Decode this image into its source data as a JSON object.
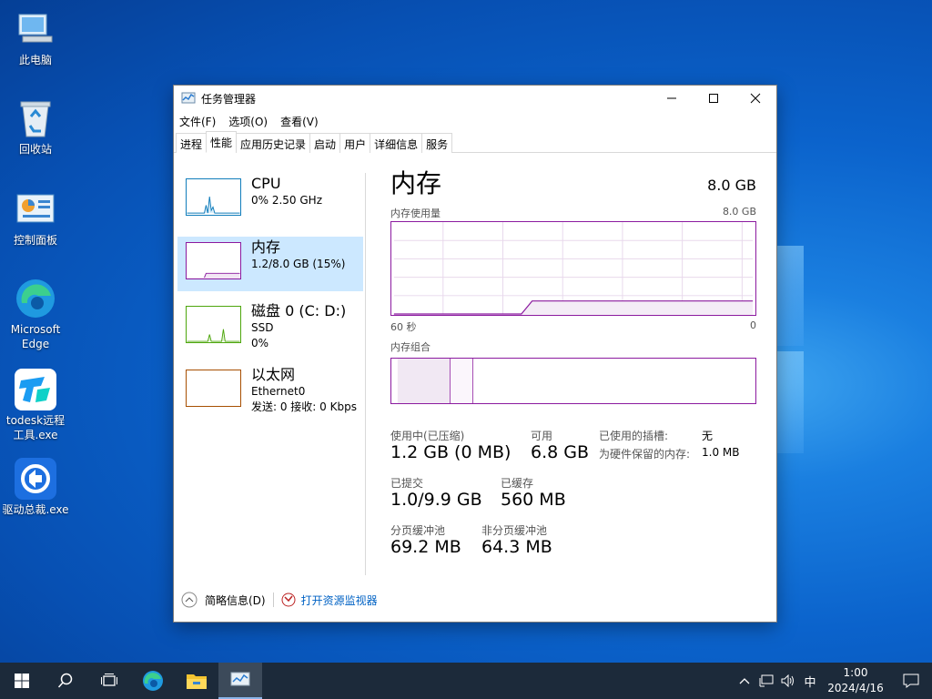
{
  "desktop": {
    "icons": [
      {
        "label": "此电脑",
        "icon": "computer-icon"
      },
      {
        "label": "回收站",
        "icon": "recycle-bin-icon"
      },
      {
        "label": "控制面板",
        "icon": "control-panel-icon"
      },
      {
        "label_line1": "Microsoft",
        "label_line2": "Edge",
        "icon": "edge-icon"
      },
      {
        "label_line1": "todesk远程",
        "label_line2": "工具.exe",
        "icon": "todesk-icon"
      },
      {
        "label": "驱动总裁.exe",
        "icon": "driver-icon"
      }
    ]
  },
  "window": {
    "title": "任务管理器",
    "menu": [
      "文件(F)",
      "选项(O)",
      "查看(V)"
    ],
    "tabs": [
      "进程",
      "性能",
      "应用历史记录",
      "启动",
      "用户",
      "详细信息",
      "服务"
    ],
    "active_tab": "性能",
    "sidebar": [
      {
        "title": "CPU",
        "line1": "0% 2.50 GHz",
        "color": "#117dbb"
      },
      {
        "title": "内存",
        "line1": "1.2/8.0 GB (15%)",
        "color": "#8b1a9f"
      },
      {
        "title": "磁盘 0 (C: D:)",
        "line1": "SSD",
        "line2": "0%",
        "color": "#4da60c"
      },
      {
        "title": "以太网",
        "line1": "Ethernet0",
        "line2": "发送: 0 接收: 0 Kbps",
        "color": "#a74f01"
      }
    ],
    "memory": {
      "title": "内存",
      "total": "8.0 GB",
      "usage_label": "内存使用量",
      "usage_max": "8.0 GB",
      "time_left": "60 秒",
      "time_right": "0",
      "composition_label": "内存组合",
      "usage_fraction": 0.15,
      "stats": {
        "in_use_label": "使用中(已压缩)",
        "in_use_value": "1.2 GB (0 MB)",
        "available_label": "可用",
        "available_value": "6.8 GB",
        "slots_label": "已使用的插槽:",
        "slots_value": "无",
        "reserved_label": "为硬件保留的内存:",
        "reserved_value": "1.0 MB",
        "committed_label": "已提交",
        "committed_value": "1.0/9.9 GB",
        "cached_label": "已缓存",
        "cached_value": "560 MB",
        "paged_label": "分页缓冲池",
        "paged_value": "69.2 MB",
        "nonpaged_label": "非分页缓冲池",
        "nonpaged_value": "64.3 MB"
      }
    },
    "footer": {
      "summary": "简略信息(D)",
      "monitor": "打开资源监视器"
    }
  },
  "taskbar": {
    "ime": "中",
    "time": "1:00",
    "date": "2024/4/16"
  },
  "colors": {
    "memory_accent": "#8b1a9f",
    "selection": "#cce8ff",
    "link": "#0062c4"
  }
}
